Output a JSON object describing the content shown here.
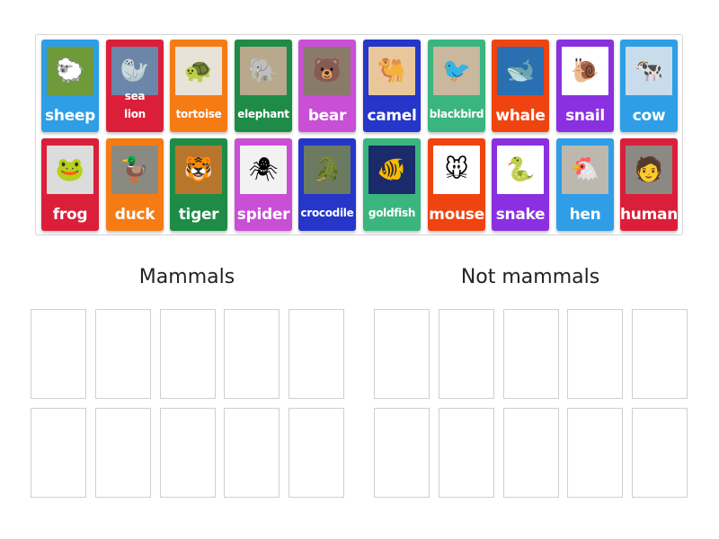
{
  "cards": [
    {
      "label": "sheep",
      "color": "#2f9ee6",
      "icon": "sheep-photo",
      "glyph": "🐑",
      "bg": "#6e9a3a"
    },
    {
      "label": "sea lion",
      "color": "#db1f3a",
      "icon": "sea-lion-photo",
      "glyph": "🦭",
      "bg": "#6b86a8"
    },
    {
      "label": "tortoise",
      "color": "#f57c14",
      "icon": "tortoise-photo",
      "glyph": "🐢",
      "bg": "#e8e2d8"
    },
    {
      "label": "elephant",
      "color": "#1e8c46",
      "icon": "elephant-photo",
      "glyph": "🐘",
      "bg": "#b8a98c"
    },
    {
      "label": "bear",
      "color": "#c84fd6",
      "icon": "bear-photo",
      "glyph": "🐻",
      "bg": "#8a7a6a"
    },
    {
      "label": "camel",
      "color": "#2536c8",
      "icon": "camel-photo",
      "glyph": "🐫",
      "bg": "#e9c79a"
    },
    {
      "label": "blackbird",
      "color": "#3bb57e",
      "icon": "blackbird-photo",
      "glyph": "🐦",
      "bg": "#c9b79e"
    },
    {
      "label": "whale",
      "color": "#f04410",
      "icon": "whale-photo",
      "glyph": "🐋",
      "bg": "#2a6fb0"
    },
    {
      "label": "snail",
      "color": "#8a30e0",
      "icon": "snail-photo",
      "glyph": "🐌",
      "bg": "#ffffff"
    },
    {
      "label": "cow",
      "color": "#2f9ee6",
      "icon": "cow-photo",
      "glyph": "🐄",
      "bg": "#c9dcec"
    },
    {
      "label": "frog",
      "color": "#db1f3a",
      "icon": "frog-photo",
      "glyph": "🐸",
      "bg": "#dcdcdc"
    },
    {
      "label": "duck",
      "color": "#f57c14",
      "icon": "duck-photo",
      "glyph": "🦆",
      "bg": "#8a8a80"
    },
    {
      "label": "tiger",
      "color": "#1e8c46",
      "icon": "tiger-photo",
      "glyph": "🐯",
      "bg": "#b8762c"
    },
    {
      "label": "spider",
      "color": "#c84fd6",
      "icon": "spider-photo",
      "glyph": "🕷",
      "bg": "#f2f2f2"
    },
    {
      "label": "crocodile",
      "color": "#2536c8",
      "icon": "crocodile-photo",
      "glyph": "🐊",
      "bg": "#6c7a62"
    },
    {
      "label": "goldfish",
      "color": "#3bb57e",
      "icon": "goldfish-photo",
      "glyph": "🐠",
      "bg": "#1a2a6a"
    },
    {
      "label": "mouse",
      "color": "#f04410",
      "icon": "mouse-photo",
      "glyph": "🐭",
      "bg": "#ffffff"
    },
    {
      "label": "snake",
      "color": "#8a30e0",
      "icon": "snake-photo",
      "glyph": "🐍",
      "bg": "#ffffff"
    },
    {
      "label": "hen",
      "color": "#2f9ee6",
      "icon": "hen-photo",
      "glyph": "🐔",
      "bg": "#bdb8ae"
    },
    {
      "label": "human",
      "color": "#db1f3a",
      "icon": "human-photo",
      "glyph": "🧑",
      "bg": "#8c8884"
    }
  ],
  "groups": [
    {
      "title": "Mammals"
    },
    {
      "title": "Not mammals"
    }
  ]
}
